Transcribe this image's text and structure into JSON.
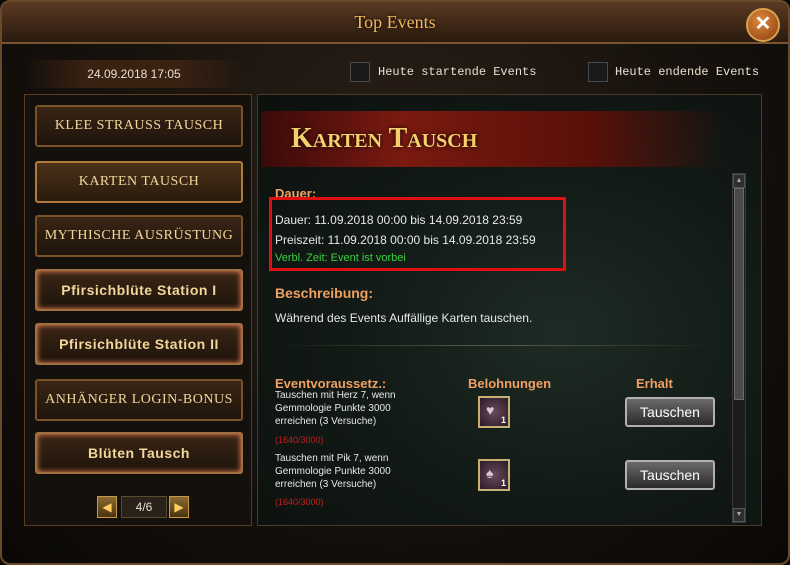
{
  "window": {
    "title": "Top Events",
    "close_glyph": "✕"
  },
  "date": "24.09.2018 17:05",
  "filters": {
    "starting": "Heute startende Events",
    "ending": "Heute endende Events"
  },
  "sidebar": {
    "items": [
      {
        "label": "Klee Strauss Tausch"
      },
      {
        "label": "Karten Tausch"
      },
      {
        "label": "Mythische Ausrüstung"
      },
      {
        "label": "Pfirsichblüte Station I"
      },
      {
        "label": "Pfirsichblüte Station II"
      },
      {
        "label": "Anhänger Login-Bonus"
      },
      {
        "label": "Blüten Tausch"
      }
    ],
    "pager": {
      "text": "4/6",
      "prev": "◀",
      "next": "▶"
    }
  },
  "event": {
    "title": "Karten Tausch",
    "duration_heading": "Dauer:",
    "duration": "Dauer: 11.09.2018 00:00 bis 14.09.2018 23:59",
    "reward_period": "Preiszeit: 11.09.2018 00:00 bis 14.09.2018 23:59",
    "remaining": "Verbl. Zeit: Event ist vorbei",
    "description_heading": "Beschreibung:",
    "description": "Während des Events Auffällige Karten tauschen.",
    "columns": {
      "requirement": "Eventvoraussetz.:",
      "rewards": "Belohnungen",
      "received": "Erhalt"
    },
    "rows": [
      {
        "requirement": "Tauschen mit Herz 7, wenn Gemmologie Punkte 3000 erreichen (3 Versuche)",
        "progress": "(1640/3000)",
        "reward_qty": "1",
        "button": "Tauschen"
      },
      {
        "requirement": "Tauschen mit Pik 7, wenn Gemmologie Punkte 3000 erreichen (3 Versuche)",
        "progress": "(1640/3000)",
        "reward_qty": "1",
        "button": "Tauschen"
      }
    ]
  },
  "colors": {
    "highlight_box": "#e01010",
    "label": "#f0a060",
    "green": "#3ad040",
    "progress": "#c02020"
  },
  "icons": [
    "close-icon",
    "card-heart-icon",
    "card-spade-icon",
    "prev-arrow-icon",
    "next-arrow-icon",
    "scroll-up-icon",
    "scroll-down-icon"
  ]
}
